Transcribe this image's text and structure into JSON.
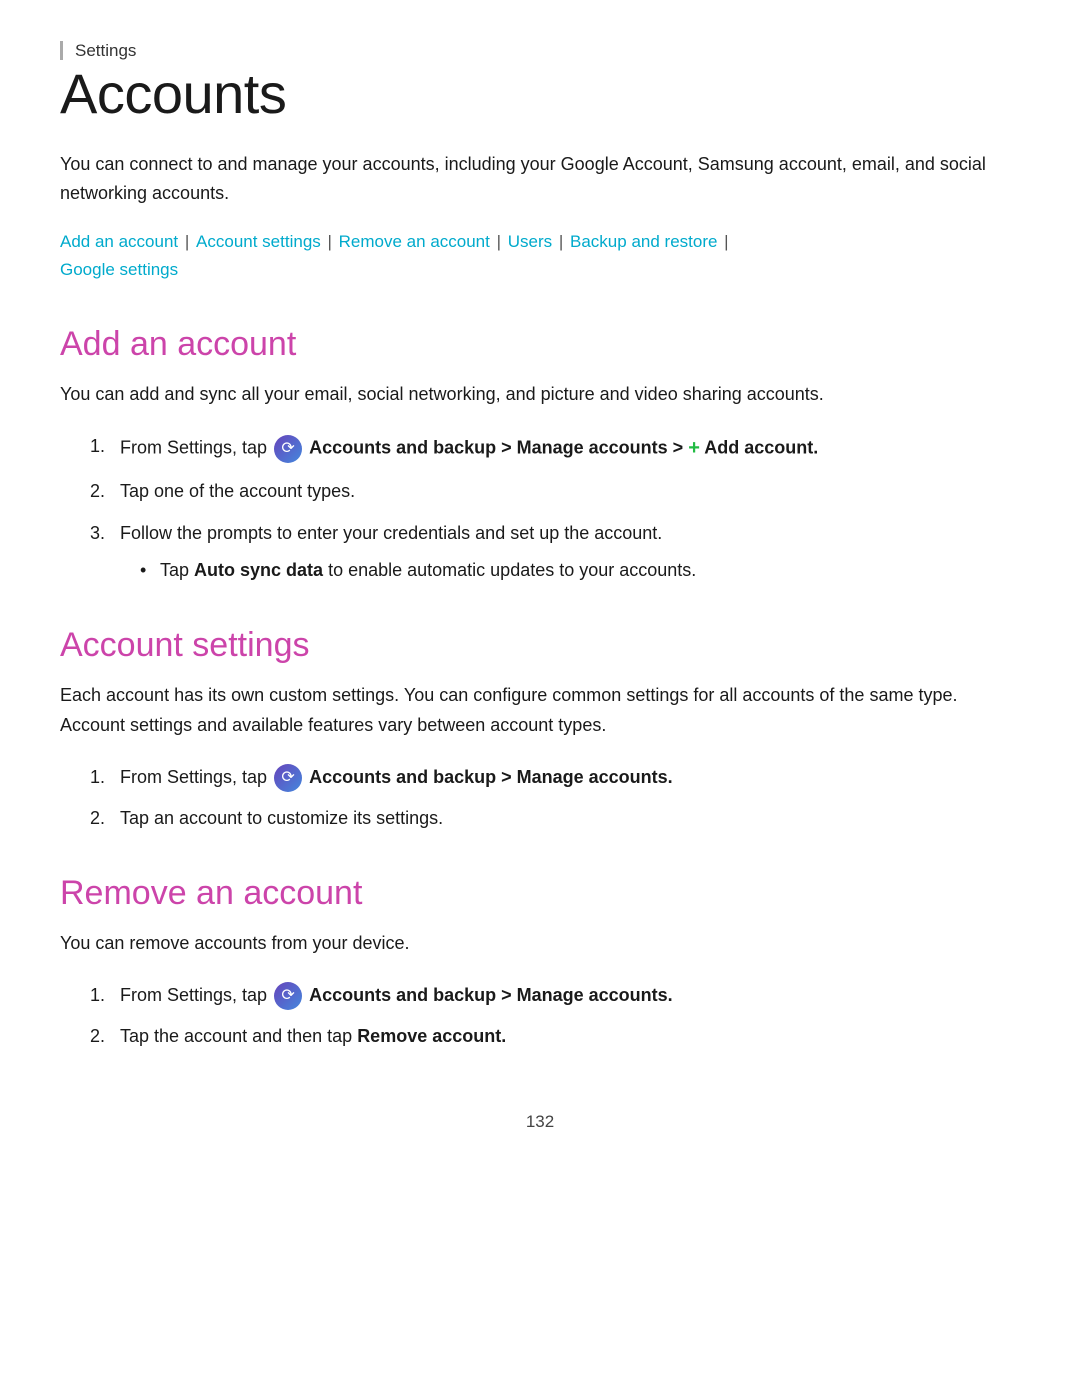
{
  "header": {
    "settings_label": "Settings"
  },
  "page": {
    "title": "Accounts",
    "intro": "You can connect to and manage your accounts, including your Google Account, Samsung account, email, and social networking accounts.",
    "page_number": "132"
  },
  "nav": {
    "links": [
      {
        "label": "Add an account",
        "id": "add-an-account"
      },
      {
        "label": "Account settings",
        "id": "account-settings"
      },
      {
        "label": "Remove an account",
        "id": "remove-an-account"
      },
      {
        "label": "Users",
        "id": "users"
      },
      {
        "label": "Backup and restore",
        "id": "backup-and-restore"
      },
      {
        "label": "Google settings",
        "id": "google-settings"
      }
    ]
  },
  "sections": [
    {
      "id": "add-an-account",
      "title": "Add an account",
      "description": "You can add and sync all your email, social networking, and picture and video sharing accounts.",
      "steps": [
        {
          "text_before": "From Settings, tap",
          "has_icon": true,
          "bold_text": "Accounts and backup > Manage accounts >",
          "add_icon": true,
          "bold_text2": "Add account."
        },
        {
          "text": "Tap one of the account types."
        },
        {
          "text": "Follow the prompts to enter your credentials and set up the account.",
          "bullet": "Tap Auto sync data to enable automatic updates to your accounts.",
          "bullet_bold": "Auto sync data"
        }
      ]
    },
    {
      "id": "account-settings",
      "title": "Account settings",
      "description": "Each account has its own custom settings. You can configure common settings for all accounts of the same type. Account settings and available features vary between account types.",
      "steps": [
        {
          "text_before": "From Settings, tap",
          "has_icon": true,
          "bold_text": "Accounts and backup > Manage accounts."
        },
        {
          "text": "Tap an account to customize its settings."
        }
      ]
    },
    {
      "id": "remove-an-account",
      "title": "Remove an account",
      "description": "You can remove accounts from your device.",
      "steps": [
        {
          "text_before": "From Settings, tap",
          "has_icon": true,
          "bold_text": "Accounts and backup > Manage accounts."
        },
        {
          "text_before_bold": "Tap the account and then tap",
          "bold_text": "Remove account."
        }
      ]
    }
  ]
}
